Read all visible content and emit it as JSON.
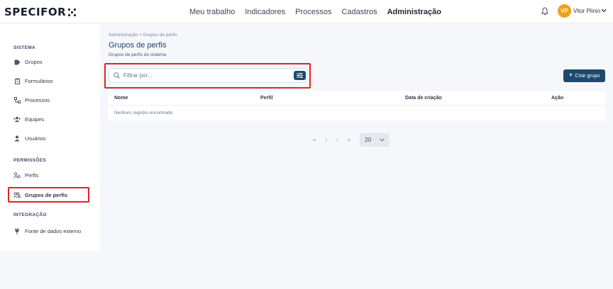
{
  "header": {
    "logo": "SPECIFOR",
    "nav": [
      {
        "label": "Meu trabalho"
      },
      {
        "label": "Indicadores"
      },
      {
        "label": "Processos"
      },
      {
        "label": "Cadastros"
      },
      {
        "label": "Administração",
        "active": true
      }
    ],
    "user": {
      "initials": "VP",
      "name": "Vitor Plinio"
    }
  },
  "sidebar": {
    "sections": [
      {
        "title": "SISTEMA",
        "items": [
          {
            "label": "Grupos",
            "icon": "tag-icon"
          },
          {
            "label": "Formulários",
            "icon": "clipboard-icon"
          },
          {
            "label": "Processos",
            "icon": "process-icon"
          },
          {
            "label": "Equipes",
            "icon": "team-icon"
          },
          {
            "label": "Usuários",
            "icon": "user-icon"
          }
        ]
      },
      {
        "title": "PERMISSÕES",
        "items": [
          {
            "label": "Perfis",
            "icon": "profile-settings-icon"
          },
          {
            "label": "Grupos de perfis",
            "icon": "profile-group-icon",
            "active": true
          }
        ]
      },
      {
        "title": "INTEGRAÇÃO",
        "items": [
          {
            "label": "Fonte de dados externo",
            "icon": "plug-icon"
          }
        ]
      }
    ]
  },
  "main": {
    "breadcrumb": "Administração  >  Grupos de perfis",
    "title": "Grupos de perfis",
    "subtitle": "Grupos de perfis do sistema",
    "search": {
      "placeholder": "Filtrar por...",
      "value": ""
    },
    "create_button": "Criar grupo",
    "table": {
      "columns": [
        "Nome",
        "Perfil",
        "Data de criação",
        "Ação"
      ],
      "empty_message": "Nenhum registro encontrado"
    },
    "pagination": {
      "first": "«",
      "prev": "‹",
      "next": "›",
      "last": "»",
      "page_size": "20"
    }
  },
  "colors": {
    "accent": "#1f4a6e",
    "title": "#1f3f73",
    "avatar": "#f0a11c",
    "highlight": "#e02424"
  }
}
